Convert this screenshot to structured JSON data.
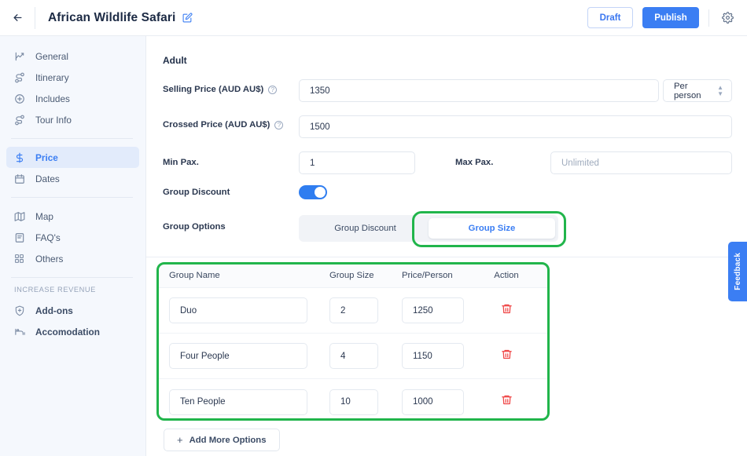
{
  "topbar": {
    "back_icon": "arrow-left-icon",
    "title": "African Wildlife Safari",
    "edit_icon": "edit-square-icon",
    "draft_label": "Draft",
    "publish_label": "Publish",
    "gear_icon": "gear-icon"
  },
  "sidebar": {
    "items": [
      {
        "label": "General",
        "icon": "chart-line-icon",
        "active": false
      },
      {
        "label": "Itinerary",
        "icon": "route-icon",
        "active": false
      },
      {
        "label": "Includes",
        "icon": "plus-circle-icon",
        "active": false
      },
      {
        "label": "Tour Info",
        "icon": "route-icon",
        "active": false
      },
      {
        "label": "Price",
        "icon": "dollar-icon",
        "active": true
      },
      {
        "label": "Dates",
        "icon": "calendar-icon",
        "active": false
      },
      {
        "label": "Map",
        "icon": "map-icon",
        "active": false
      },
      {
        "label": "FAQ's",
        "icon": "document-icon",
        "active": false
      },
      {
        "label": "Others",
        "icon": "grid-icon",
        "active": false
      }
    ],
    "section_label": "INCREASE REVENUE",
    "revenue_items": [
      {
        "label": "Add-ons",
        "icon": "shield-plus-icon"
      },
      {
        "label": "Accomodation",
        "icon": "bed-icon"
      }
    ]
  },
  "main": {
    "section_title": "Adult",
    "selling_price": {
      "label": "Selling Price (AUD AU$)",
      "help_icon": "question-circle-icon",
      "value": "1350",
      "unit_value": "Per person",
      "unit_icon": "chevron-updown-icon"
    },
    "crossed_price": {
      "label": "Crossed Price (AUD AU$)",
      "help_icon": "question-circle-icon",
      "value": "1500"
    },
    "min_pax": {
      "label": "Min Pax.",
      "value": "1"
    },
    "max_pax": {
      "label": "Max Pax.",
      "value": "",
      "placeholder": "Unlimited"
    },
    "group_discount": {
      "label": "Group Discount",
      "toggle_on": "on"
    },
    "group_options": {
      "label": "Group Options",
      "tabs": [
        {
          "label": "Group Discount",
          "selected": false
        },
        {
          "label": "Group Size",
          "selected": true
        }
      ]
    },
    "table": {
      "headers": [
        "Group Name",
        "Group Size",
        "Price/Person",
        "Action"
      ],
      "rows": [
        {
          "name": "Duo",
          "size": "2",
          "price": "1250",
          "action_icon": "trash-icon"
        },
        {
          "name": "Four People",
          "size": "4",
          "price": "1150",
          "action_icon": "trash-icon"
        },
        {
          "name": "Ten People",
          "size": "10",
          "price": "1000",
          "action_icon": "trash-icon"
        }
      ]
    },
    "add_more": {
      "label": "Add More Options",
      "icon": "plus-icon"
    }
  },
  "feedback": {
    "label": "Feedback"
  },
  "colors": {
    "accent_blue": "#3b7ef3",
    "annotation_green": "#21b54b",
    "danger_red": "#ef4444",
    "sidebar_bg": "#f5f8fd"
  }
}
